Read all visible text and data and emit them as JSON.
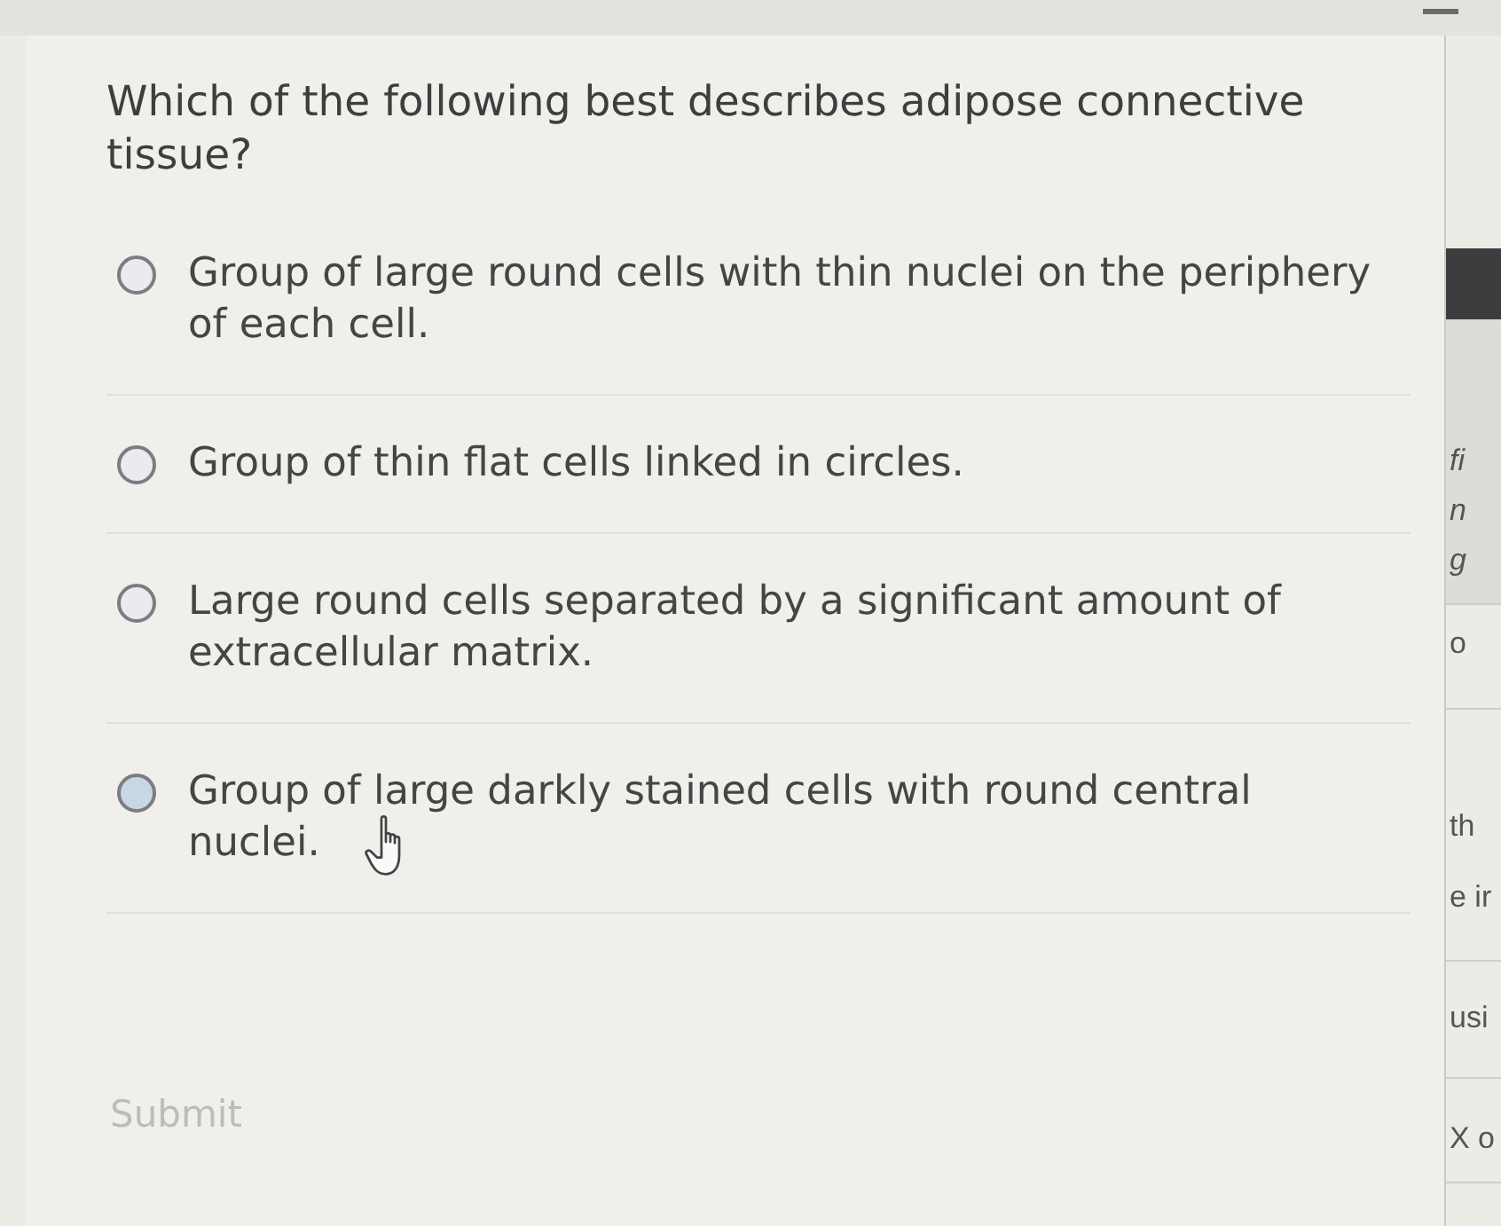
{
  "question": {
    "text": "Which of the following best describes adipose connective tissue?"
  },
  "options": [
    {
      "label": "Group of large round cells with thin nuclei on the periphery of each cell.",
      "selected": false,
      "hovered": false
    },
    {
      "label": "Group of thin flat cells linked in circles.",
      "selected": false,
      "hovered": false
    },
    {
      "label": "Large round cells separated by a significant amount of extracellular matrix.",
      "selected": false,
      "hovered": false
    },
    {
      "label": "Group of large darkly stained cells with round central nuclei.",
      "selected": false,
      "hovered": true
    }
  ],
  "submit": {
    "label": "Submit",
    "disabled": true
  },
  "side_panel": {
    "sections": [
      {
        "kind": "hint",
        "lines": [
          "fi",
          "n",
          "g"
        ]
      },
      {
        "kind": "plain",
        "lines": [
          "o"
        ]
      },
      {
        "kind": "plain",
        "lines": [
          "th",
          "e ir"
        ]
      },
      {
        "kind": "plain",
        "lines": [
          "usi"
        ]
      },
      {
        "kind": "plain",
        "lines": [
          "X o"
        ]
      }
    ]
  }
}
